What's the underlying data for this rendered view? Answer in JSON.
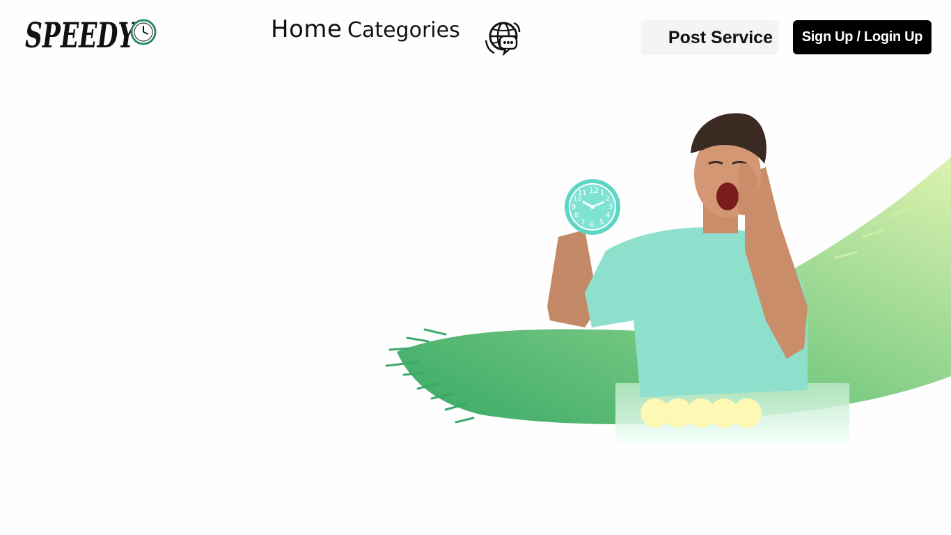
{
  "header": {
    "logo_text": "SPEEDY",
    "nav": {
      "home": "Home",
      "categories": "Categories"
    },
    "language_icon": "globe-chat-icon",
    "post_service_label": "Post Service",
    "signup_login_label": "Sign Up / Login Up"
  },
  "hero": {
    "image": "man-holding-alarm-clock-shouting",
    "clock_numbers": [
      "12",
      "1",
      "2",
      "3",
      "4",
      "5",
      "6",
      "7",
      "8",
      "9",
      "10",
      "11"
    ],
    "rating_dots": 5
  },
  "colors": {
    "accent_green": "#3aa86b",
    "light_green": "#cfeea0",
    "shirt_teal": "#8ee0cc",
    "dot_yellow": "#fdf8b4",
    "button_black": "#000000",
    "button_light": "#f3f4f5"
  }
}
